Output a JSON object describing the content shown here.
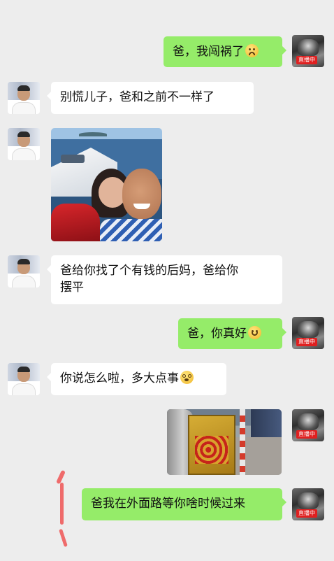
{
  "messages": [
    {
      "side": "right",
      "type": "text",
      "text": "爸，我闯祸了",
      "emoji": "frowning-face"
    },
    {
      "side": "left",
      "type": "text",
      "text": "别慌儿子，爸和之前不一样了"
    },
    {
      "side": "left",
      "type": "image",
      "description": "yacht selfie"
    },
    {
      "side": "left",
      "type": "text",
      "line1": "爸给你找了个有钱的后妈，爸给你",
      "line2": "摆平"
    },
    {
      "side": "right",
      "type": "text",
      "text": "爸，你真好",
      "emoji": "smiling-face"
    },
    {
      "side": "left",
      "type": "text",
      "text": "你说怎么啦，多大点事",
      "emoji": "dizzy-face"
    },
    {
      "side": "right",
      "type": "image",
      "description": "street photo"
    },
    {
      "side": "right",
      "type": "text",
      "text": "爸我在外面路等你啥时候过来"
    }
  ],
  "son_avatar": {
    "badge": "直播中"
  },
  "colors": {
    "background": "#ededed",
    "sent_bubble": "#95ec69",
    "received_bubble": "#ffffff",
    "annotation": "#ef6b6b"
  }
}
